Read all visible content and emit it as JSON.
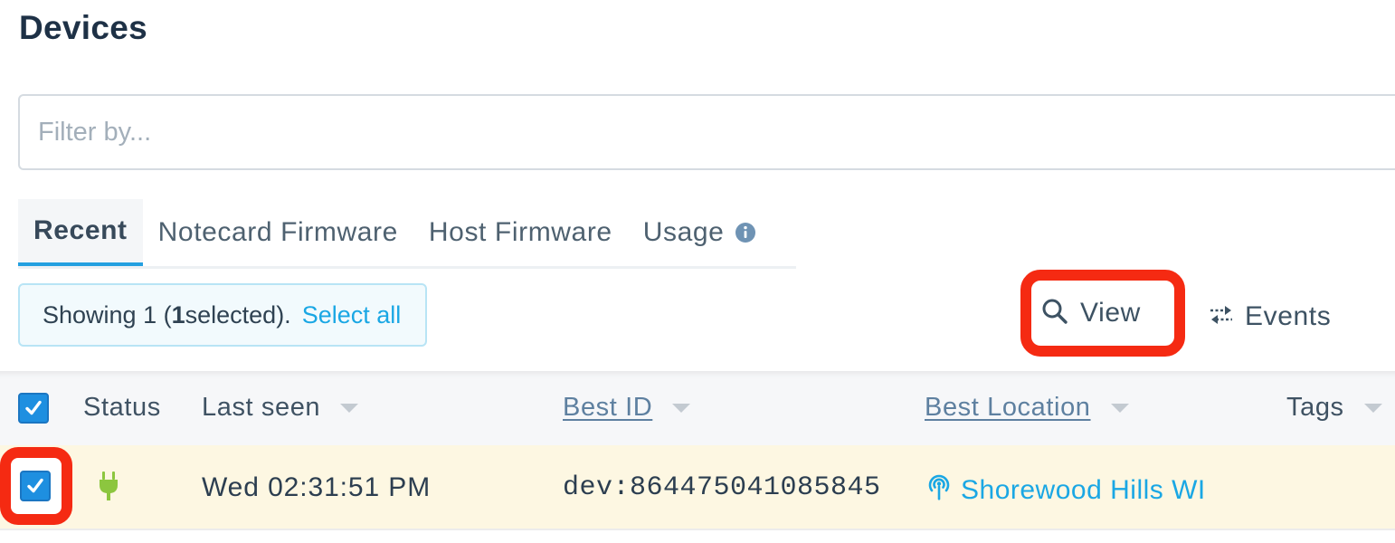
{
  "page": {
    "title": "Devices"
  },
  "filter": {
    "placeholder": "Filter by...",
    "value": ""
  },
  "tabs": [
    {
      "label": "Recent",
      "active": true
    },
    {
      "label": "Notecard Firmware",
      "active": false
    },
    {
      "label": "Host Firmware",
      "active": false
    },
    {
      "label": "Usage",
      "active": false,
      "icon": "info-icon"
    }
  ],
  "selection": {
    "prefix": "Showing 1 (",
    "count": "1",
    "suffix": " selected).",
    "select_all_label": "Select all"
  },
  "toolbar": {
    "view": {
      "label": "View",
      "icon": "search-icon"
    },
    "events": {
      "label": "Events",
      "icon": "arrows-exchange-icon"
    }
  },
  "table": {
    "header_checked": true,
    "columns": {
      "status": "Status",
      "last_seen": "Last seen",
      "best_id": "Best ID",
      "best_location": "Best Location",
      "tags": "Tags"
    },
    "rows": [
      {
        "checked": true,
        "status_icon": "plug-icon",
        "last_seen": "Wed 02:31:51 PM",
        "best_id": "dev:864475041085845",
        "location_icon": "cell-tower-icon",
        "best_location": "Shorewood Hills WI"
      }
    ]
  },
  "colors": {
    "accent": "#1aa7e4",
    "highlight": "#f52a12",
    "selected_row": "#fdf7e2",
    "status_connected": "#8cc63f",
    "checkbox": "#1e8fe0"
  }
}
